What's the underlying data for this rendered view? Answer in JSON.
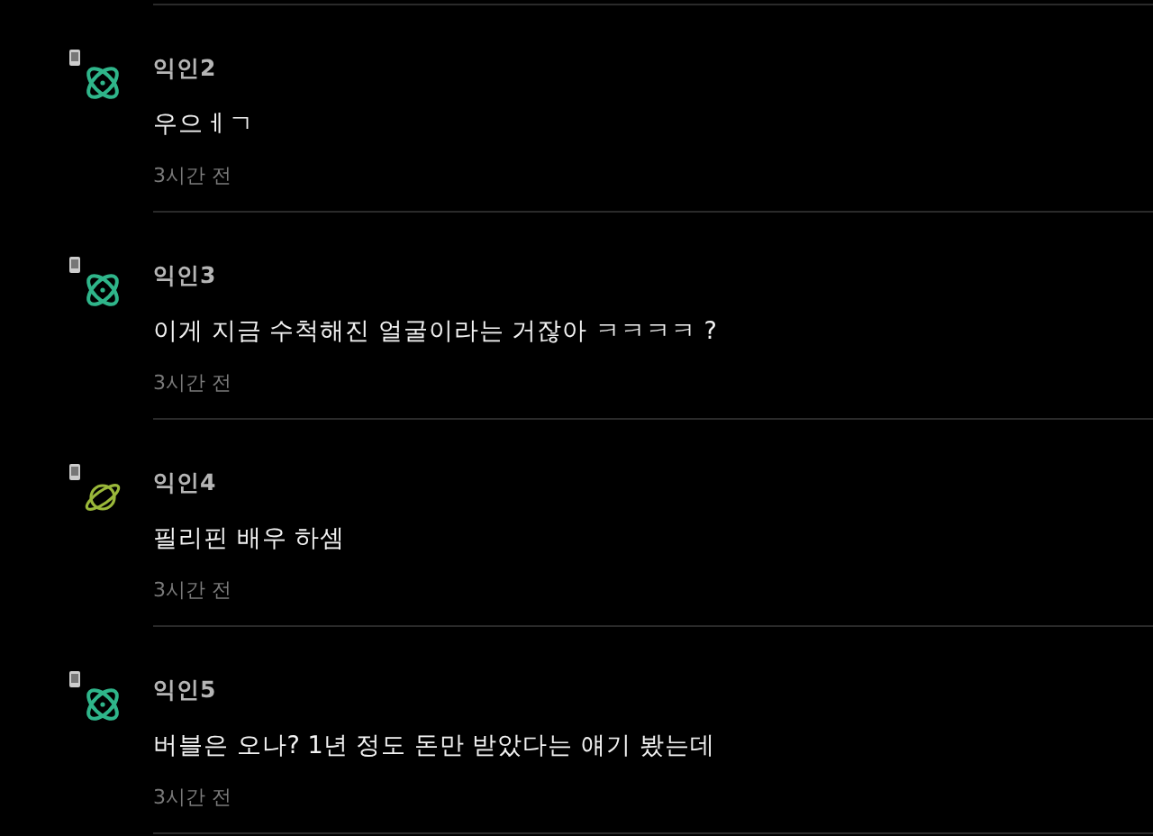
{
  "comments": [
    {
      "author": "익인2",
      "text": "우으ㅔㄱ",
      "time": "3시간 전",
      "avatar": {
        "kind": "atom",
        "color": "#2fb58a"
      }
    },
    {
      "author": "익인3",
      "text": "이게 지금 수척해진 얼굴이라는 거잖아 ㅋㅋㅋㅋ ?",
      "time": "3시간 전",
      "avatar": {
        "kind": "atom",
        "color": "#2fb58a"
      }
    },
    {
      "author": "익인4",
      "text": "필리핀 배우 하셈",
      "time": "3시간 전",
      "avatar": {
        "kind": "planet",
        "color": "#9ab83a"
      }
    },
    {
      "author": "익인5",
      "text": "버블은 오나? 1년 정도 돈만 받았다는 얘기 봤는데",
      "time": "3시간 전",
      "avatar": {
        "kind": "atom",
        "color": "#2fb58a"
      }
    }
  ]
}
